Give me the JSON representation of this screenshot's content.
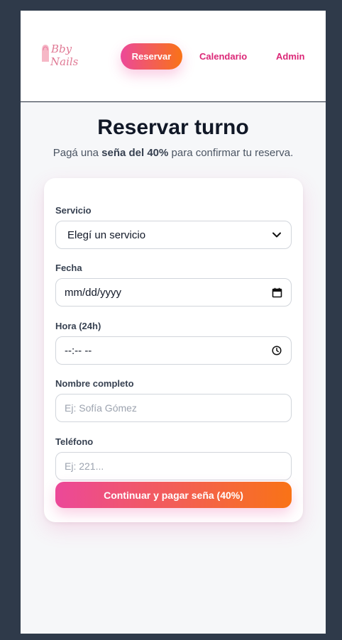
{
  "header": {
    "logo_line1": "Bby",
    "logo_line2": "Nails",
    "nav": {
      "reservar": "Reservar",
      "calendario": "Calendario",
      "admin": "Admin"
    }
  },
  "main": {
    "title": "Reservar turno",
    "subtitle_before": "Pagá una ",
    "subtitle_bold": "seña del 40%",
    "subtitle_after": " para confirmar tu reserva."
  },
  "form": {
    "servicio": {
      "label": "Servicio",
      "value": "Elegí un servicio"
    },
    "fecha": {
      "label": "Fecha",
      "value": "mm/dd/yyyy"
    },
    "hora": {
      "label": "Hora (24h)",
      "value": "--:-- --"
    },
    "nombre": {
      "label": "Nombre completo",
      "placeholder": "Ej: Sofía Gómez"
    },
    "telefono": {
      "label": "Teléfono",
      "placeholder": "Ej: 221..."
    },
    "submit": "Continuar y pagar seña (40%)"
  },
  "colors": {
    "accent_start": "#ec4899",
    "accent_end": "#f97316",
    "nav_link": "#db2777"
  },
  "icons": {
    "select": "chevron-down-icon",
    "date": "calendar-icon",
    "time": "clock-icon"
  }
}
